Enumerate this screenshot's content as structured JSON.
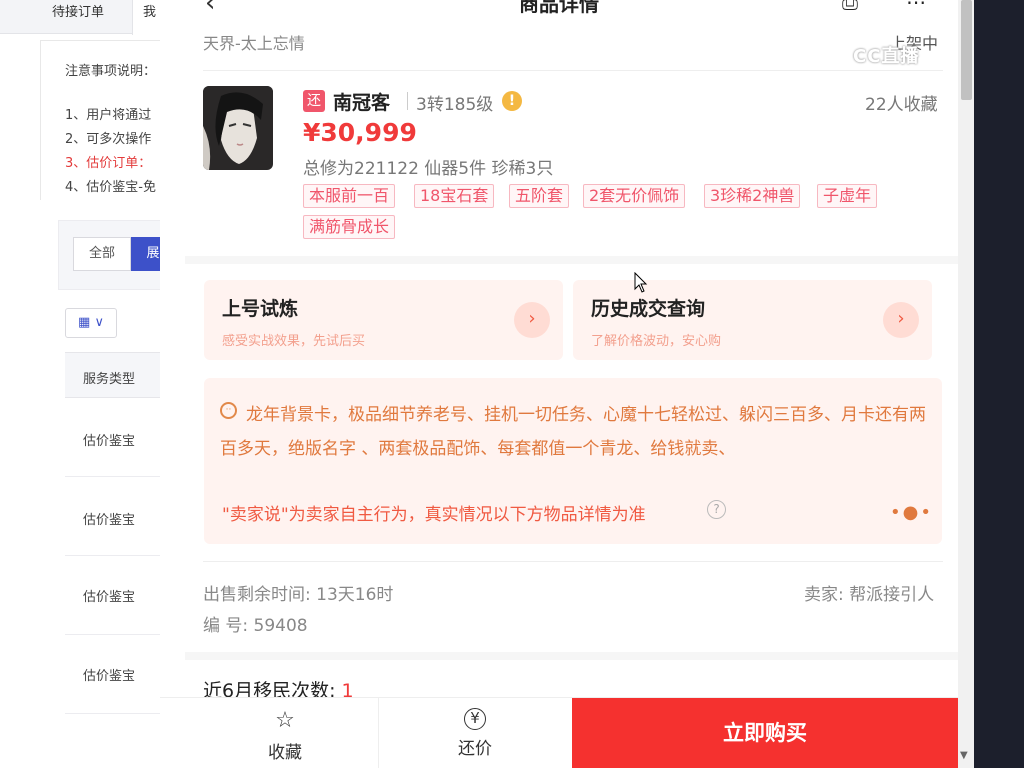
{
  "background_page": {
    "tabs": [
      "待接订单",
      "我"
    ],
    "notice_title": "注意事项说明：",
    "notice_items": [
      "1、用户将通过",
      "2、可多次操作",
      "3、估价订单：",
      "4、估价鉴宝-免"
    ],
    "filter_buttons": [
      "全部",
      "展"
    ],
    "grid_toggle": "▦ ∨",
    "table_header": "服务类型",
    "rows": [
      "估价鉴宝",
      "估价鉴宝",
      "估价鉴宝",
      "估价鉴宝"
    ]
  },
  "header": {
    "back_icon": "back-chevron-icon",
    "title": "商品详情",
    "share_icon": "share-icon",
    "more_icon": "more-icon"
  },
  "listing": {
    "server": "天界-太上忘情",
    "status": "上架中",
    "watermark": "CC直播",
    "badge": "还",
    "name": "南冠客",
    "level": "3转185级",
    "favorites": "22人收藏",
    "price": "¥30,999",
    "stats": "总修为221122  仙器5件  珍稀3只",
    "tags": [
      "本服前一百",
      "18宝石套",
      "五阶套",
      "2套无价佩饰",
      "3珍稀2神兽",
      "子虚年",
      "满筋骨成长"
    ]
  },
  "cards": {
    "trial": {
      "title": "上号试炼",
      "subtitle": "感受实战效果，先试后买"
    },
    "history": {
      "title": "历史成交查询",
      "subtitle": "了解价格波动，安心购"
    }
  },
  "seller_says": {
    "text": "龙年背景卡，极品细节养老号、挂机一切任务、心魔十七轻松过、躲闪三百多、月卡还有两百多天，绝版名字 、两套极品配饰、每套都值一个青龙、给钱就卖、",
    "note": "\"卖家说\"为卖家自主行为，真实情况以下方物品详情为准",
    "dots": "•●•"
  },
  "meta": {
    "remaining_time": "出售剩余时间: 13天16时",
    "listing_no": "编 号: 59408",
    "seller": "卖家: 帮派接引人"
  },
  "migration": {
    "label": "近6月移民次数: ",
    "count": "1"
  },
  "bottom_bar": {
    "favorite": "收藏",
    "bargain": "还价",
    "buy": "立即购买"
  },
  "colors": {
    "accent_red": "#f5312f",
    "price_red": "#f03a3a",
    "tag_pink": "#f0566b",
    "card_bg": "#fff3f0",
    "seller_text": "#e0793e"
  }
}
